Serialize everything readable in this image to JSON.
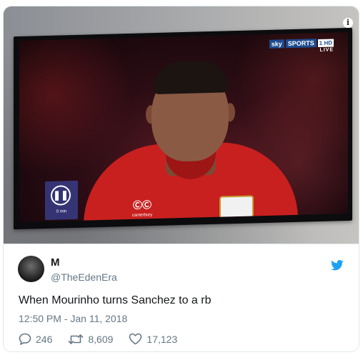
{
  "media": {
    "tv_overlay": {
      "channel_brand": "sky",
      "channel_name": "SPORTS",
      "channel_number": "1 HD",
      "live_label": "LIVE",
      "pause_label": "0 min",
      "jersey_logo": "canterbury"
    },
    "info_icon": "info-icon"
  },
  "tweet": {
    "display_name": "M",
    "handle": "@TheEdenEra",
    "text": "When Mourinho turns Sanchez to a rb",
    "timestamp": "12:50 PM - Jan 11, 2018",
    "replies": "246",
    "retweets": "8,609",
    "likes": "17,123",
    "icons": {
      "reply": "reply-icon",
      "retweet": "retweet-icon",
      "like": "heart-icon",
      "brand": "twitter-bird-icon"
    },
    "colors": {
      "brand_blue": "#1da1f2",
      "text": "#14171a",
      "secondary": "#657786"
    }
  }
}
